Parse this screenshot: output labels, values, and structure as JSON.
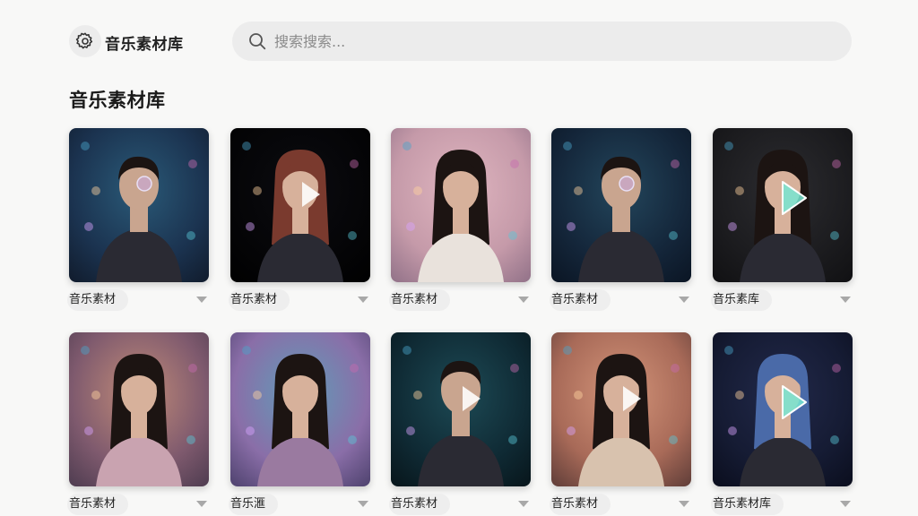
{
  "app": {
    "title": "音乐素材库"
  },
  "search": {
    "placeholder": "搜索搜索..."
  },
  "section": {
    "title": "音乐素材库"
  },
  "cards": [
    {
      "label": "音乐素材",
      "palette": [
        "#1b3350",
        "#2a5a78",
        "#101a2a"
      ],
      "person": "male",
      "overlay": "glasses-circle"
    },
    {
      "label": "音乐素材",
      "palette": [
        "#050507",
        "#0b0b10",
        "#000000"
      ],
      "person": "female-red",
      "overlay": "play"
    },
    {
      "label": "音乐素材",
      "palette": [
        "#c59aa9",
        "#e0b6c0",
        "#8e6f86"
      ],
      "person": "female-light",
      "overlay": "none"
    },
    {
      "label": "音乐素材",
      "palette": [
        "#14263a",
        "#23465c",
        "#0a1422"
      ],
      "person": "male-hood",
      "overlay": "glasses-circle"
    },
    {
      "label": "音乐素库",
      "palette": [
        "#1c1c1f",
        "#2c2c30",
        "#101012"
      ],
      "person": "female-dark",
      "overlay": "play-teal"
    },
    {
      "label": "音乐素材",
      "palette": [
        "#7f5a6e",
        "#c28c78",
        "#4b3a4e"
      ],
      "person": "female-pink",
      "overlay": "none"
    },
    {
      "label": "音乐滙",
      "palette": [
        "#8a6ea8",
        "#5f9db8",
        "#4a3f6a"
      ],
      "person": "female-purple",
      "overlay": "none"
    },
    {
      "label": "音乐素材",
      "palette": [
        "#0f2a34",
        "#1d4a55",
        "#071419"
      ],
      "person": "male-dark",
      "overlay": "play"
    },
    {
      "label": "音乐素材",
      "palette": [
        "#a86a58",
        "#d4957a",
        "#5a3a36"
      ],
      "person": "female-warm",
      "overlay": "play"
    },
    {
      "label": "音乐素材库",
      "palette": [
        "#151b33",
        "#22294a",
        "#0a0d1c"
      ],
      "person": "female-blue",
      "overlay": "play-teal"
    }
  ]
}
